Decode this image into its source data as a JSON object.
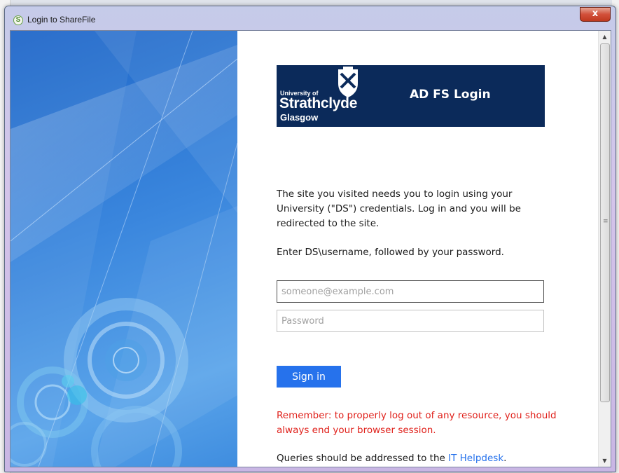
{
  "window": {
    "title": "Login to ShareFile",
    "close_glyph": "x"
  },
  "banner": {
    "university_of": "University of",
    "strathclyde": "Strathclyde",
    "glasgow": "Glasgow",
    "heading": "AD FS Login"
  },
  "intro_text": "The site you visited needs you to login using your University (\"DS\") credentials. Log in and you will be redirected to the site.",
  "instruction_text": "Enter DS\\username, followed by your password.",
  "form": {
    "username_placeholder": "someone@example.com",
    "username_value": "",
    "password_placeholder": "Password",
    "signin_label": "Sign in"
  },
  "remember_text": "Remember: to properly log out of any resource, you should always end your browser session.",
  "queries": {
    "prefix": "Queries should be addressed to the ",
    "link_text": "IT Helpdesk",
    "suffix": "."
  },
  "colors": {
    "banner_bg": "#0b2a5a",
    "accent": "#2672ec",
    "warning_text": "#e0211b"
  },
  "icons": {
    "app": "sharefile-icon",
    "close": "close-icon",
    "scroll_up": "arrow-up-icon",
    "scroll_down": "arrow-down-icon"
  }
}
